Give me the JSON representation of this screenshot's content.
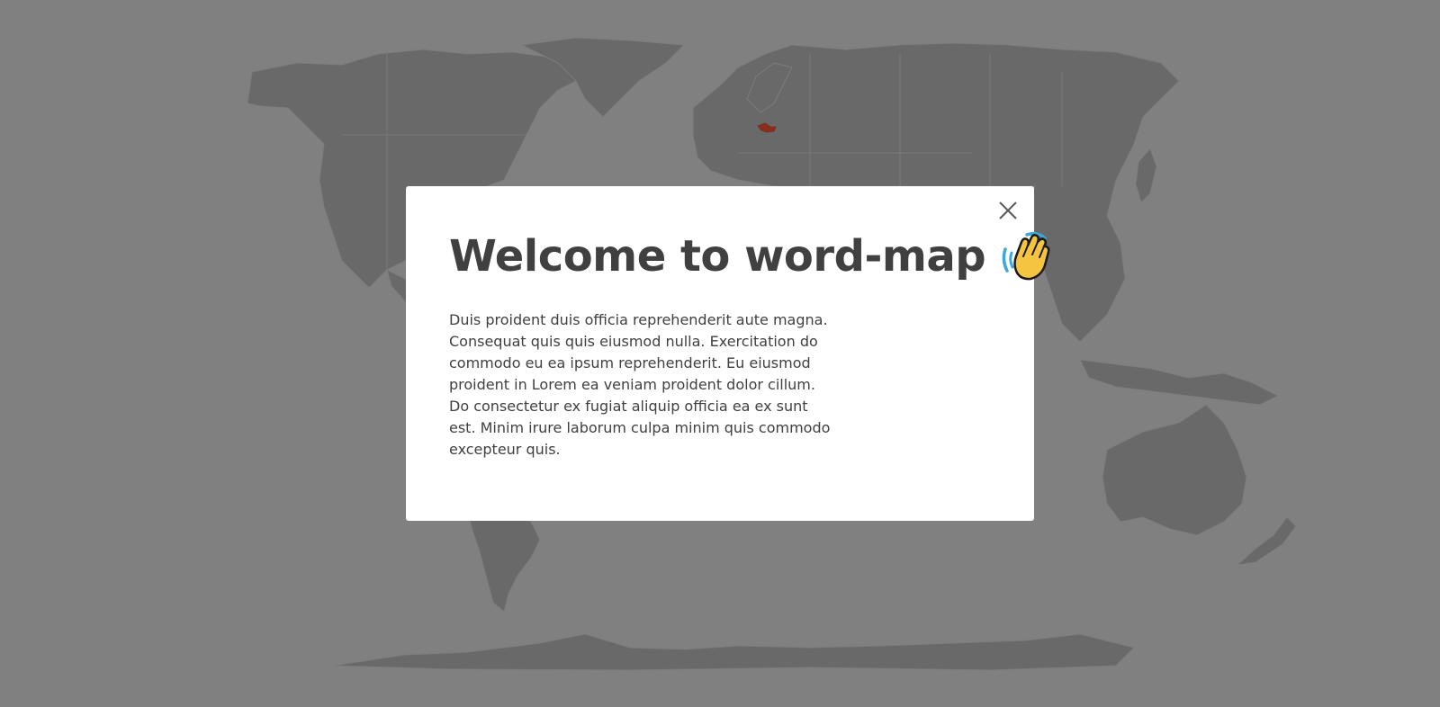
{
  "background": {
    "overlay_color": "#808080",
    "land_color": "#696969",
    "highlighted_country": {
      "name": "Czech Republic",
      "color": "#8b2e1c"
    }
  },
  "modal": {
    "title": "Welcome to word-map",
    "title_icon": "waving-hand-icon",
    "close_icon": "close-icon",
    "body": "Duis proident duis officia reprehenderit aute magna. Consequat quis quis eiusmod nulla. Exercitation do commodo eu ea ipsum reprehenderit. Eu eiusmod proident in Lorem ea veniam proident dolor cillum. Do consectetur ex fugiat aliquip officia ea ex sunt est. Minim irure laborum culpa minim quis commodo excepteur quis."
  }
}
